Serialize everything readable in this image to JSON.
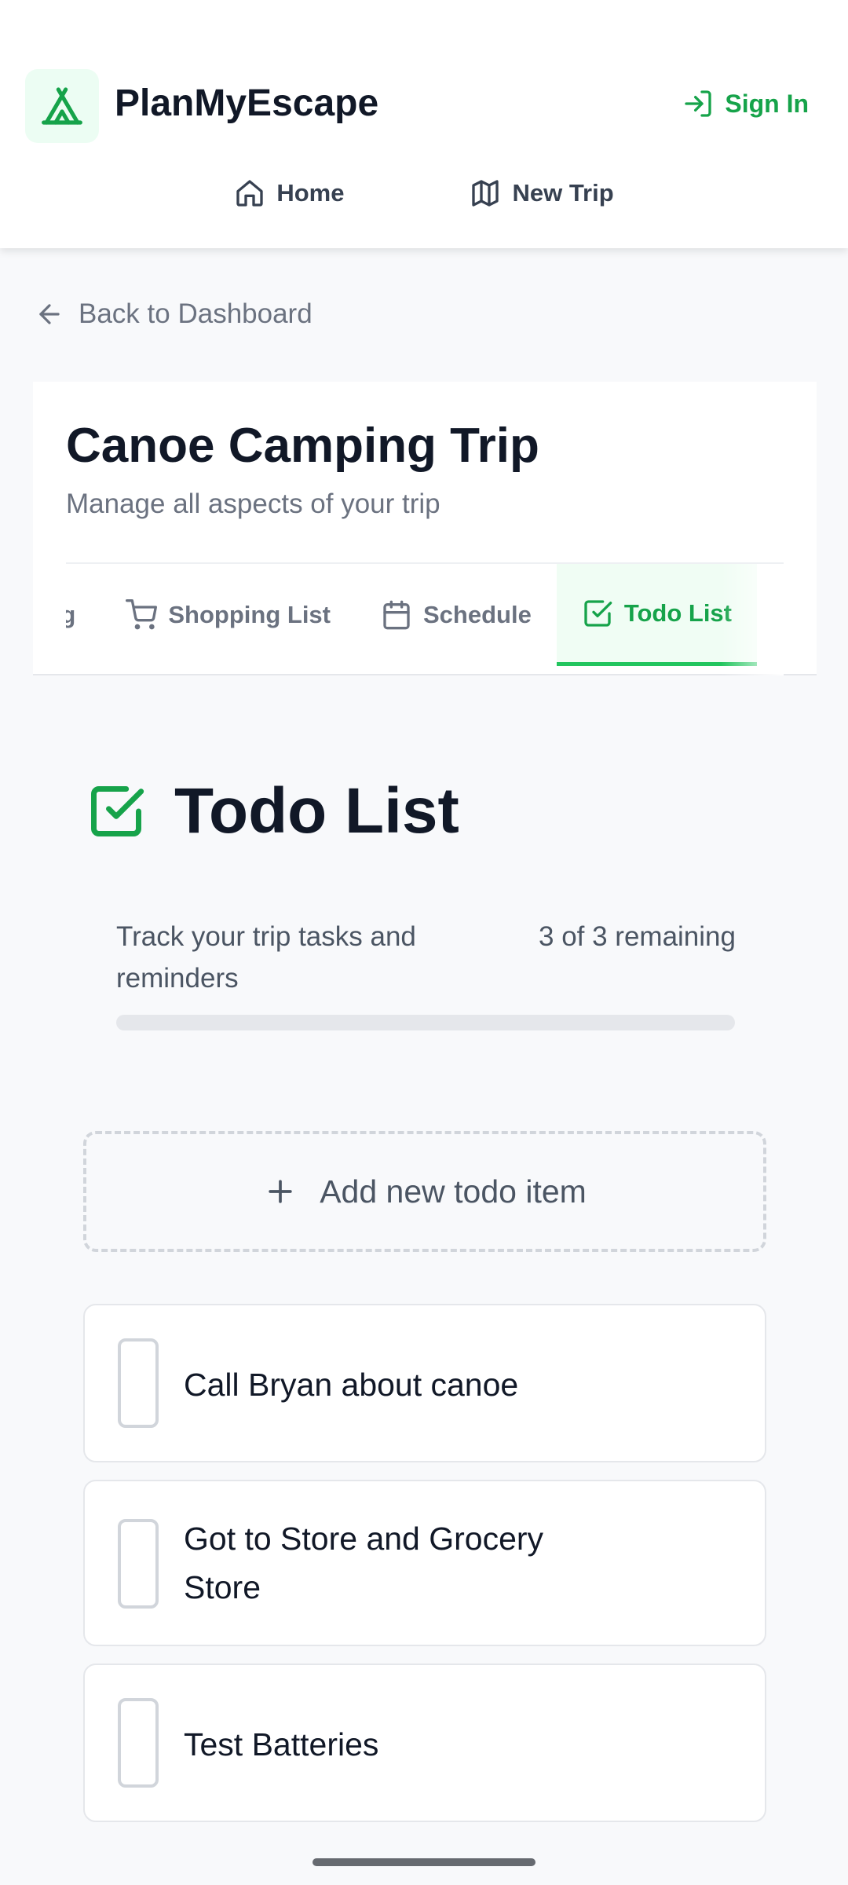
{
  "app": {
    "title": "PlanMyEscape",
    "sign_in": "Sign In",
    "brand_color": "#16a34a"
  },
  "nav": [
    {
      "label": "Home",
      "icon": "home-icon"
    },
    {
      "label": "New Trip",
      "icon": "map-icon"
    }
  ],
  "back_link": "Back to Dashboard",
  "trip": {
    "title": "Canoe Camping Trip",
    "subtitle": "Manage all aspects of your trip"
  },
  "tabs": [
    {
      "label": "Meal Planning",
      "visible_text": "nning",
      "icon": "none",
      "active": false
    },
    {
      "label": "Shopping List",
      "icon": "shopping-cart-icon",
      "active": false
    },
    {
      "label": "Schedule",
      "icon": "calendar-icon",
      "active": false
    },
    {
      "label": "Todo List",
      "icon": "check-square-icon",
      "active": true
    }
  ],
  "todo_section": {
    "title": "Todo List",
    "description": "Track your trip tasks and reminders",
    "remaining_text": "3 of 3 remaining",
    "progress_fraction": 0,
    "add_label": "Add new todo item",
    "items": [
      {
        "text": "Call Bryan about canoe",
        "done": false
      },
      {
        "text": "Got to Store and Grocery Store",
        "done": false
      },
      {
        "text": "Test Batteries",
        "done": false
      }
    ]
  }
}
